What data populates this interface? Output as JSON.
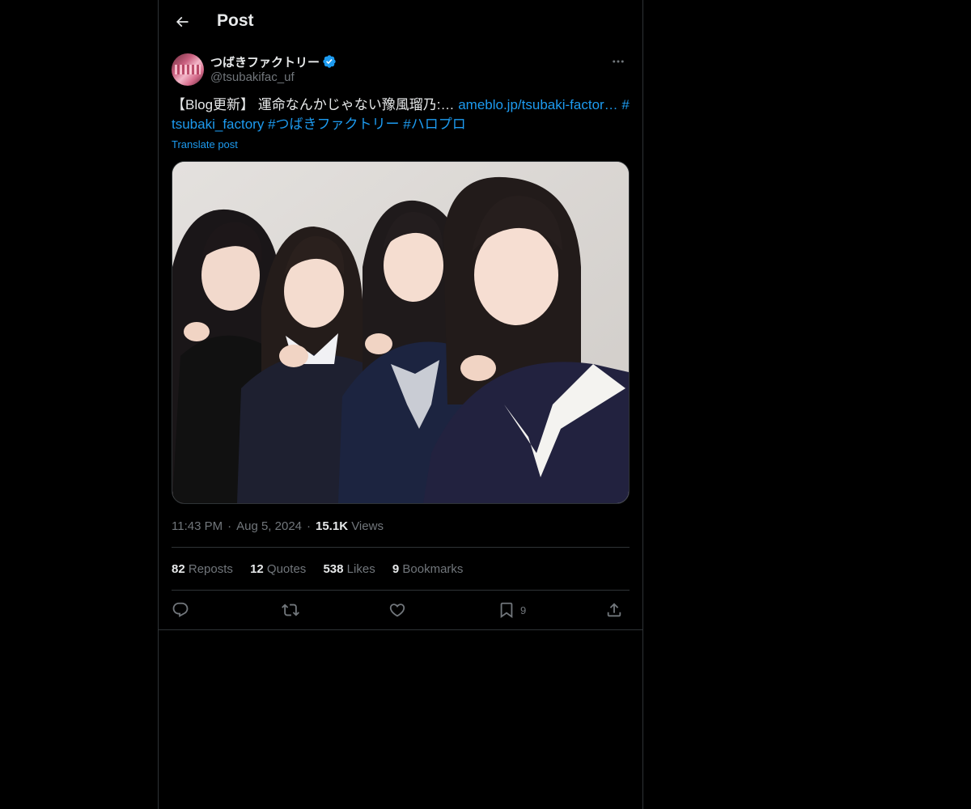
{
  "header": {
    "title": "Post",
    "back_icon": "arrow-left-icon"
  },
  "author": {
    "display_name": "つばきファクトリー",
    "handle": "@tsubakifac_uf",
    "verified_icon": "verified-badge-icon",
    "verified_color": "#1d9bf0"
  },
  "post": {
    "text_prefix": "【Blog更新】 運命なんかじゃない豫風瑠乃:… ",
    "link_text": "ameblo.jp/tsubaki-factor…",
    "hashtag_1": "#tsubaki_factory",
    "hashtag_2": "#つばきファクトリー",
    "hashtag_3": "#ハロプロ",
    "translate_label": "Translate post"
  },
  "meta": {
    "time": "11:43 PM",
    "date": "Aug 5, 2024",
    "views_count": "15.1K",
    "views_label": "Views"
  },
  "stats": {
    "reposts_count": "82",
    "reposts_label": "Reposts",
    "quotes_count": "12",
    "quotes_label": "Quotes",
    "likes_count": "538",
    "likes_label": "Likes",
    "bookmarks_count": "9",
    "bookmarks_label": "Bookmarks"
  },
  "actions": {
    "reply_icon": "reply-icon",
    "repost_icon": "repost-icon",
    "like_icon": "heart-icon",
    "bookmark_icon": "bookmark-icon",
    "bookmark_count": "9",
    "share_icon": "share-icon"
  },
  "colors": {
    "background": "#000000",
    "text": "#e7e9ea",
    "muted": "#71767b",
    "accent": "#1d9bf0",
    "border": "#2f3336"
  }
}
